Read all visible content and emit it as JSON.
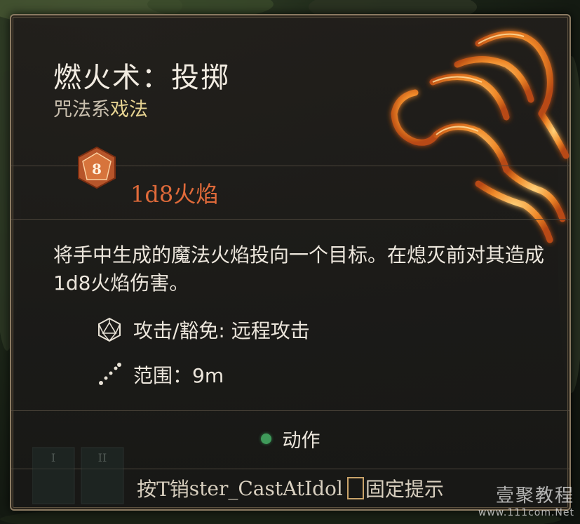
{
  "spell": {
    "title": "燃火术：投掷",
    "school": "咒法系",
    "kind": "戏法",
    "die_label": "8",
    "damage": "1d8火焰",
    "description": "将手中生成的魔法火焰投向一个目标。在熄灭前对其造成1d8火焰伤害。",
    "attack_save": "攻击/豁免: 远程攻击",
    "range": "范围：9m",
    "cost": "动作",
    "hint_prefix": "按T销",
    "hint_key": "ster_CastAtIdol",
    "hint_suffix": "固定提示"
  },
  "hotbar": {
    "slot1": "I",
    "slot2": "II"
  },
  "watermark": {
    "name": "壹聚教程",
    "url": "www.111com.Net"
  },
  "colors": {
    "damage": "#e06a3a",
    "kind": "#e6d391",
    "action_dot": "#3f9a5a",
    "frame": "#8a7a62"
  },
  "icons": {
    "die": "d8-die-icon",
    "attack": "d20-icon",
    "range": "dotted-line-icon",
    "hand": "flaming-hand-icon"
  }
}
